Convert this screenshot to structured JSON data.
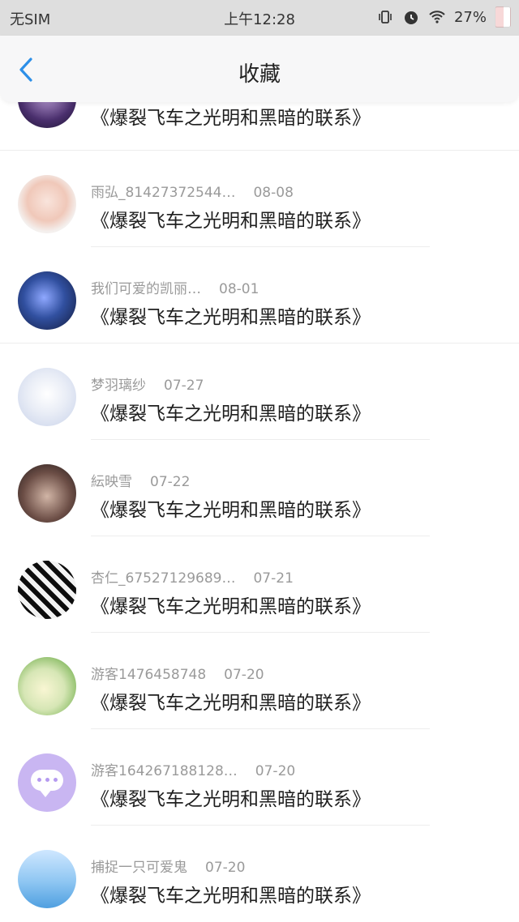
{
  "status_bar": {
    "carrier": "无SIM",
    "time": "上午12:28",
    "battery": "27%",
    "icons": [
      "vibrate-icon",
      "alarm-icon",
      "wifi-icon",
      "battery-icon"
    ]
  },
  "header": {
    "title": "收藏",
    "back_icon": "chevron-left-icon"
  },
  "colors": {
    "accent": "#2c8fe8",
    "title_text": "#1e1e1e",
    "meta_text": "#9a9a9a",
    "divider": "#ededed"
  },
  "favorites": [
    {
      "author": "",
      "date": "",
      "title": "《爆裂飞车之光明和黑暗的联系》"
    },
    {
      "author": "雨弘_81427372544…",
      "date": "08-08",
      "title": "《爆裂飞车之光明和黑暗的联系》"
    },
    {
      "author": "我们可爱的凯丽…",
      "date": "08-01",
      "title": "《爆裂飞车之光明和黑暗的联系》"
    },
    {
      "author": "梦羽璃纱",
      "date": "07-27",
      "title": "《爆裂飞车之光明和黑暗的联系》"
    },
    {
      "author": "紜映雪",
      "date": "07-22",
      "title": "《爆裂飞车之光明和黑暗的联系》"
    },
    {
      "author": "杏仁_67527129689…",
      "date": "07-21",
      "title": "《爆裂飞车之光明和黑暗的联系》"
    },
    {
      "author": "游客1476458748",
      "date": "07-20",
      "title": "《爆裂飞车之光明和黑暗的联系》"
    },
    {
      "author": "游客164267188128…",
      "date": "07-20",
      "title": "《爆裂飞车之光明和黑暗的联系》"
    },
    {
      "author": "捕捉一只可爱鬼",
      "date": "07-20",
      "title": "《爆裂飞车之光明和黑暗的联系》"
    }
  ]
}
